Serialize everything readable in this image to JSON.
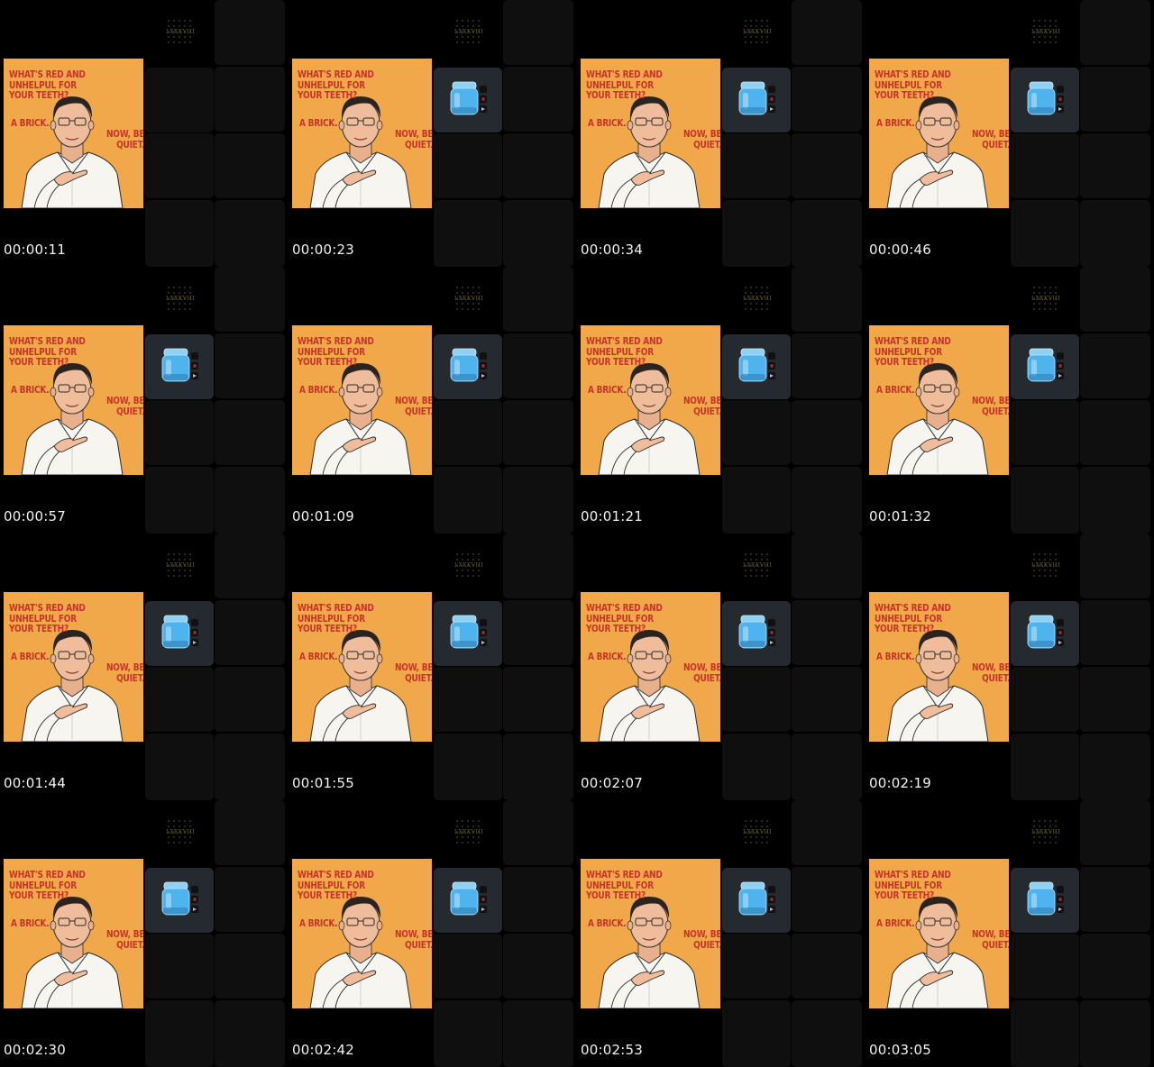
{
  "sheet": {
    "tag_text": "LXXXVIII",
    "poster": {
      "question": "WHAT'S RED AND\nUNHELPUL FOR\nYOUR TEETH?",
      "answer": "A BRICK.",
      "tail": "NOW, BE\nQUIET."
    },
    "colors": {
      "background": "#000000",
      "poster_bg": "#f0a84a",
      "caption_red": "#c6342a",
      "tile_dark": "#0f0f0f",
      "thumb_tile": "#242a30",
      "jar_blue": "#4fb3ee"
    },
    "frames": [
      {
        "timecode": "00:00:11",
        "thumb_visible": false
      },
      {
        "timecode": "00:00:23",
        "thumb_visible": true
      },
      {
        "timecode": "00:00:34",
        "thumb_visible": true
      },
      {
        "timecode": "00:00:46",
        "thumb_visible": true
      },
      {
        "timecode": "00:00:57",
        "thumb_visible": true
      },
      {
        "timecode": "00:01:09",
        "thumb_visible": true
      },
      {
        "timecode": "00:01:21",
        "thumb_visible": true
      },
      {
        "timecode": "00:01:32",
        "thumb_visible": true
      },
      {
        "timecode": "00:01:44",
        "thumb_visible": true
      },
      {
        "timecode": "00:01:55",
        "thumb_visible": true
      },
      {
        "timecode": "00:02:07",
        "thumb_visible": true
      },
      {
        "timecode": "00:02:19",
        "thumb_visible": true
      },
      {
        "timecode": "00:02:30",
        "thumb_visible": true
      },
      {
        "timecode": "00:02:42",
        "thumb_visible": true
      },
      {
        "timecode": "00:02:53",
        "thumb_visible": true
      },
      {
        "timecode": "00:03:05",
        "thumb_visible": true
      }
    ],
    "icons": {
      "thumbnail": "jar-icon",
      "side": "app-side-icons"
    }
  }
}
